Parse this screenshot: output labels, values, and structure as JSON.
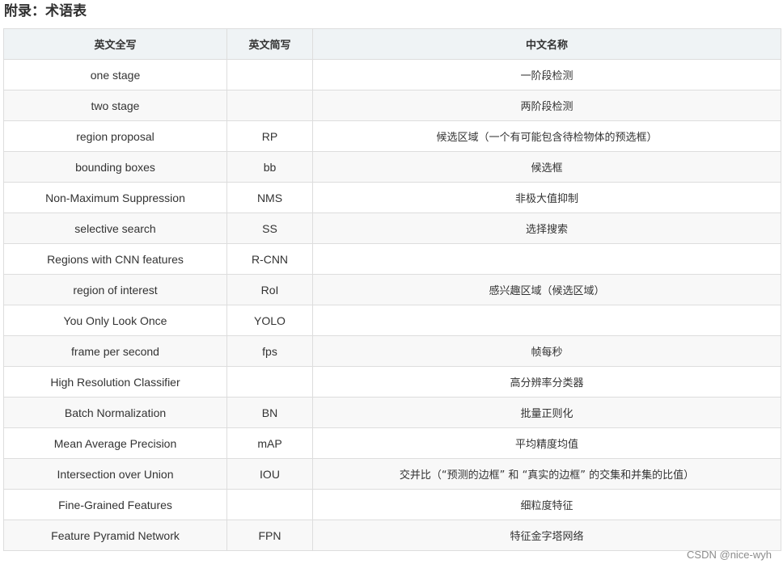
{
  "heading": "附录：术语表",
  "table": {
    "headers": [
      "英文全写",
      "英文简写",
      "中文名称"
    ],
    "rows": [
      {
        "en": "one stage",
        "abbr": "",
        "cn": "一阶段检测"
      },
      {
        "en": "two stage",
        "abbr": "",
        "cn": "两阶段检测"
      },
      {
        "en": "region proposal",
        "abbr": "RP",
        "cn": "候选区域（一个有可能包含待检物体的预选框）"
      },
      {
        "en": "bounding boxes",
        "abbr": "bb",
        "cn": "候选框"
      },
      {
        "en": "Non-Maximum Suppression",
        "abbr": "NMS",
        "cn": "非极大值抑制"
      },
      {
        "en": "selective search",
        "abbr": "SS",
        "cn": "选择搜索"
      },
      {
        "en": "Regions with CNN features",
        "abbr": "R-CNN",
        "cn": ""
      },
      {
        "en": "region of interest",
        "abbr": "RoI",
        "cn": "感兴趣区域（候选区域）"
      },
      {
        "en": "You Only Look Once",
        "abbr": "YOLO",
        "cn": ""
      },
      {
        "en": "frame per second",
        "abbr": "fps",
        "cn": "帧每秒"
      },
      {
        "en": "High Resolution Classifier",
        "abbr": "",
        "cn": "高分辨率分类器"
      },
      {
        "en": "Batch Normalization",
        "abbr": "BN",
        "cn": "批量正则化"
      },
      {
        "en": "Mean Average Precision",
        "abbr": "mAP",
        "cn": "平均精度均值"
      },
      {
        "en": "Intersection over Union",
        "abbr": "IOU",
        "cn": "交并比（“预测的边框” 和 “真实的边框” 的交集和并集的比值）"
      },
      {
        "en": "Fine-Grained Features",
        "abbr": "",
        "cn": "细粒度特征"
      },
      {
        "en": "Feature Pyramid Network",
        "abbr": "FPN",
        "cn": "特征金字塔网络"
      }
    ]
  },
  "watermark": "CSDN @nice-wyh"
}
